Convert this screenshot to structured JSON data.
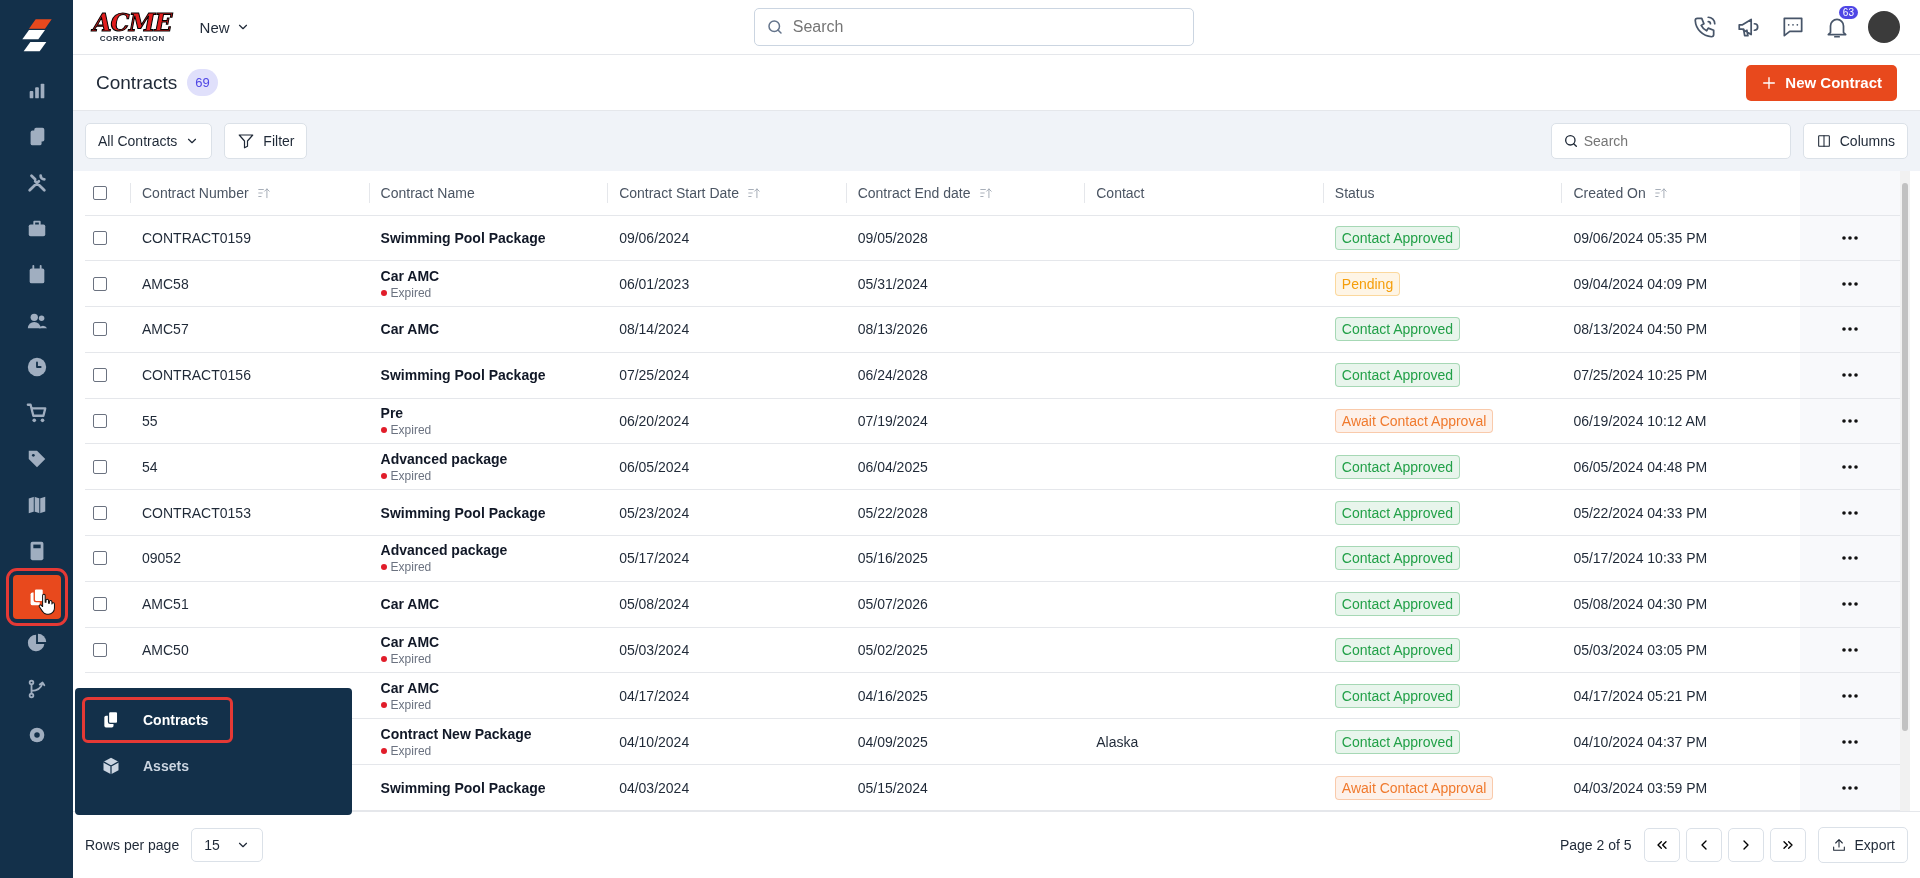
{
  "sidebar": {
    "items": [
      {
        "selected": false
      },
      {
        "selected": false
      },
      {
        "selected": false
      },
      {
        "selected": false
      },
      {
        "selected": false
      },
      {
        "selected": false
      },
      {
        "selected": false
      },
      {
        "selected": false
      },
      {
        "selected": false
      },
      {
        "selected": false
      },
      {
        "selected": false
      },
      {
        "selected": true
      },
      {
        "selected": false
      },
      {
        "selected": false
      },
      {
        "selected": false
      }
    ]
  },
  "flyout_menu": {
    "items": [
      {
        "label": "Contracts",
        "selected": true
      },
      {
        "label": "Assets",
        "selected": false
      }
    ]
  },
  "topbar": {
    "logo_text": "ACME",
    "logo_subtext": "CORPORATION",
    "new_menu": "New",
    "search": {
      "placeholder": "Search"
    },
    "notification_count": "63"
  },
  "page_header": {
    "title": "Contracts",
    "count": "69",
    "primary_button": "New Contract"
  },
  "toolbar": {
    "view_select": "All Contracts",
    "filter_button": "Filter",
    "search": {
      "placeholder": "Search"
    },
    "columns_button": "Columns"
  },
  "table": {
    "select_all_checked": false,
    "columns": [
      {
        "label": "Contract Number",
        "sortable": true
      },
      {
        "label": "Contract Name",
        "sortable": false
      },
      {
        "label": "Contract Start Date",
        "sortable": true
      },
      {
        "label": "Contract End date",
        "sortable": true
      },
      {
        "label": "Contact",
        "sortable": false
      },
      {
        "label": "Status",
        "sortable": false
      },
      {
        "label": "Created On",
        "sortable": true
      }
    ],
    "rows": [
      {
        "number": "CONTRACT0159",
        "name": "Swimming Pool Package",
        "start": "09/06/2024",
        "end": "09/05/2028",
        "contact": "",
        "status": "Contact Approved",
        "color": "#22a048",
        "created": "09/06/2024 05:35 PM",
        "checked": false
      },
      {
        "number": "AMC58",
        "name": "Car AMC",
        "note": "Expired",
        "start": "06/01/2023",
        "end": "05/31/2024",
        "contact": "",
        "status": "Pending",
        "color": "#f59e0b",
        "created": "09/04/2024 04:09 PM",
        "checked": false
      },
      {
        "number": "AMC57",
        "name": "Car AMC",
        "start": "08/14/2024",
        "end": "08/13/2026",
        "contact": "",
        "status": "Contact Approved",
        "color": "#22a048",
        "created": "08/13/2024 04:50 PM",
        "checked": false
      },
      {
        "number": "CONTRACT0156",
        "name": "Swimming Pool Package",
        "start": "07/25/2024",
        "end": "06/24/2028",
        "contact": "",
        "status": "Contact Approved",
        "color": "#22a048",
        "created": "07/25/2024 10:25 PM",
        "checked": false
      },
      {
        "number": "55",
        "name": "Pre",
        "note": "Expired",
        "start": "06/20/2024",
        "end": "07/19/2024",
        "contact": "",
        "status": "Await Contact Approval",
        "color": "#f07a2e",
        "created": "06/19/2024 10:12 AM",
        "checked": false
      },
      {
        "number": "54",
        "name": "Advanced package",
        "note": "Expired",
        "start": "06/05/2024",
        "end": "06/04/2025",
        "contact": "",
        "status": "Contact Approved",
        "color": "#22a048",
        "created": "06/05/2024 04:48 PM",
        "checked": false
      },
      {
        "number": "CONTRACT0153",
        "name": "Swimming Pool Package",
        "start": "05/23/2024",
        "end": "05/22/2028",
        "contact": "",
        "status": "Contact Approved",
        "color": "#22a048",
        "created": "05/22/2024 04:33 PM",
        "checked": false
      },
      {
        "number": "09052",
        "name": "Advanced package",
        "note": "Expired",
        "start": "05/17/2024",
        "end": "05/16/2025",
        "contact": "",
        "status": "Contact Approved",
        "color": "#22a048",
        "created": "05/17/2024 10:33 PM",
        "checked": false
      },
      {
        "number": "AMC51",
        "name": "Car AMC",
        "start": "05/08/2024",
        "end": "05/07/2026",
        "contact": "",
        "status": "Contact Approved",
        "color": "#22a048",
        "created": "05/08/2024 04:30 PM",
        "checked": false
      },
      {
        "number": "AMC50",
        "name": "Car AMC",
        "note": "Expired",
        "start": "05/03/2024",
        "end": "05/02/2025",
        "contact": "",
        "status": "Contact Approved",
        "color": "#22a048",
        "created": "05/03/2024 03:05 PM",
        "checked": false
      },
      {
        "number": "",
        "name": "Car AMC",
        "note": "Expired",
        "start": "04/17/2024",
        "end": "04/16/2025",
        "contact": "",
        "status": "Contact Approved",
        "color": "#22a048",
        "created": "04/17/2024 05:21 PM"
      },
      {
        "number": "",
        "name": "Contract New Package",
        "note": "Expired",
        "start": "04/10/2024",
        "end": "04/09/2025",
        "contact": "Alaska",
        "status": "Contact Approved",
        "color": "#22a048",
        "created": "04/10/2024 04:37 PM"
      },
      {
        "number": "",
        "name": "Swimming Pool Package",
        "start": "04/03/2024",
        "end": "05/15/2024",
        "contact": "",
        "status": "Await Contact Approval",
        "color": "#f07a2e",
        "created": "04/03/2024 03:59 PM"
      }
    ]
  },
  "footer": {
    "rows_per_page_label": "Rows per page",
    "rows_per_page": "15",
    "page_info": "Page 2 of 5",
    "export_button": "Export"
  }
}
